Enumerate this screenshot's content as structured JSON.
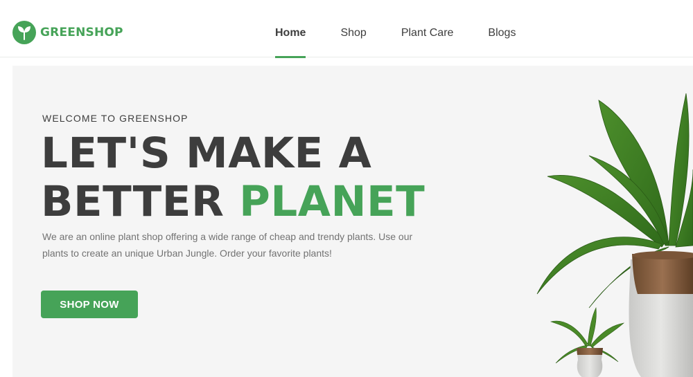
{
  "brand": {
    "name": "GREENSHOP",
    "color": "#46a358"
  },
  "nav": {
    "items": [
      {
        "label": "Home",
        "active": true
      },
      {
        "label": "Shop",
        "active": false
      },
      {
        "label": "Plant Care",
        "active": false
      },
      {
        "label": "Blogs",
        "active": false
      }
    ]
  },
  "hero": {
    "eyebrow": "WELCOME TO GREENSHOP",
    "headline_line1": "LET'S MAKE A",
    "headline_line2_prefix": "BETTER ",
    "headline_line2_accent": "PLANET",
    "description": "We are an online plant shop offering a wide range of cheap and trendy plants. Use our plants to create an unique Urban Jungle. Order your favorite plants!",
    "cta_label": "SHOP NOW"
  },
  "icons": {
    "logo": "leaf-icon",
    "hero_image": "potted-plant-image"
  },
  "colors": {
    "text": "#3d3d3d",
    "muted": "#727272",
    "hero_bg": "#f5f5f5"
  }
}
